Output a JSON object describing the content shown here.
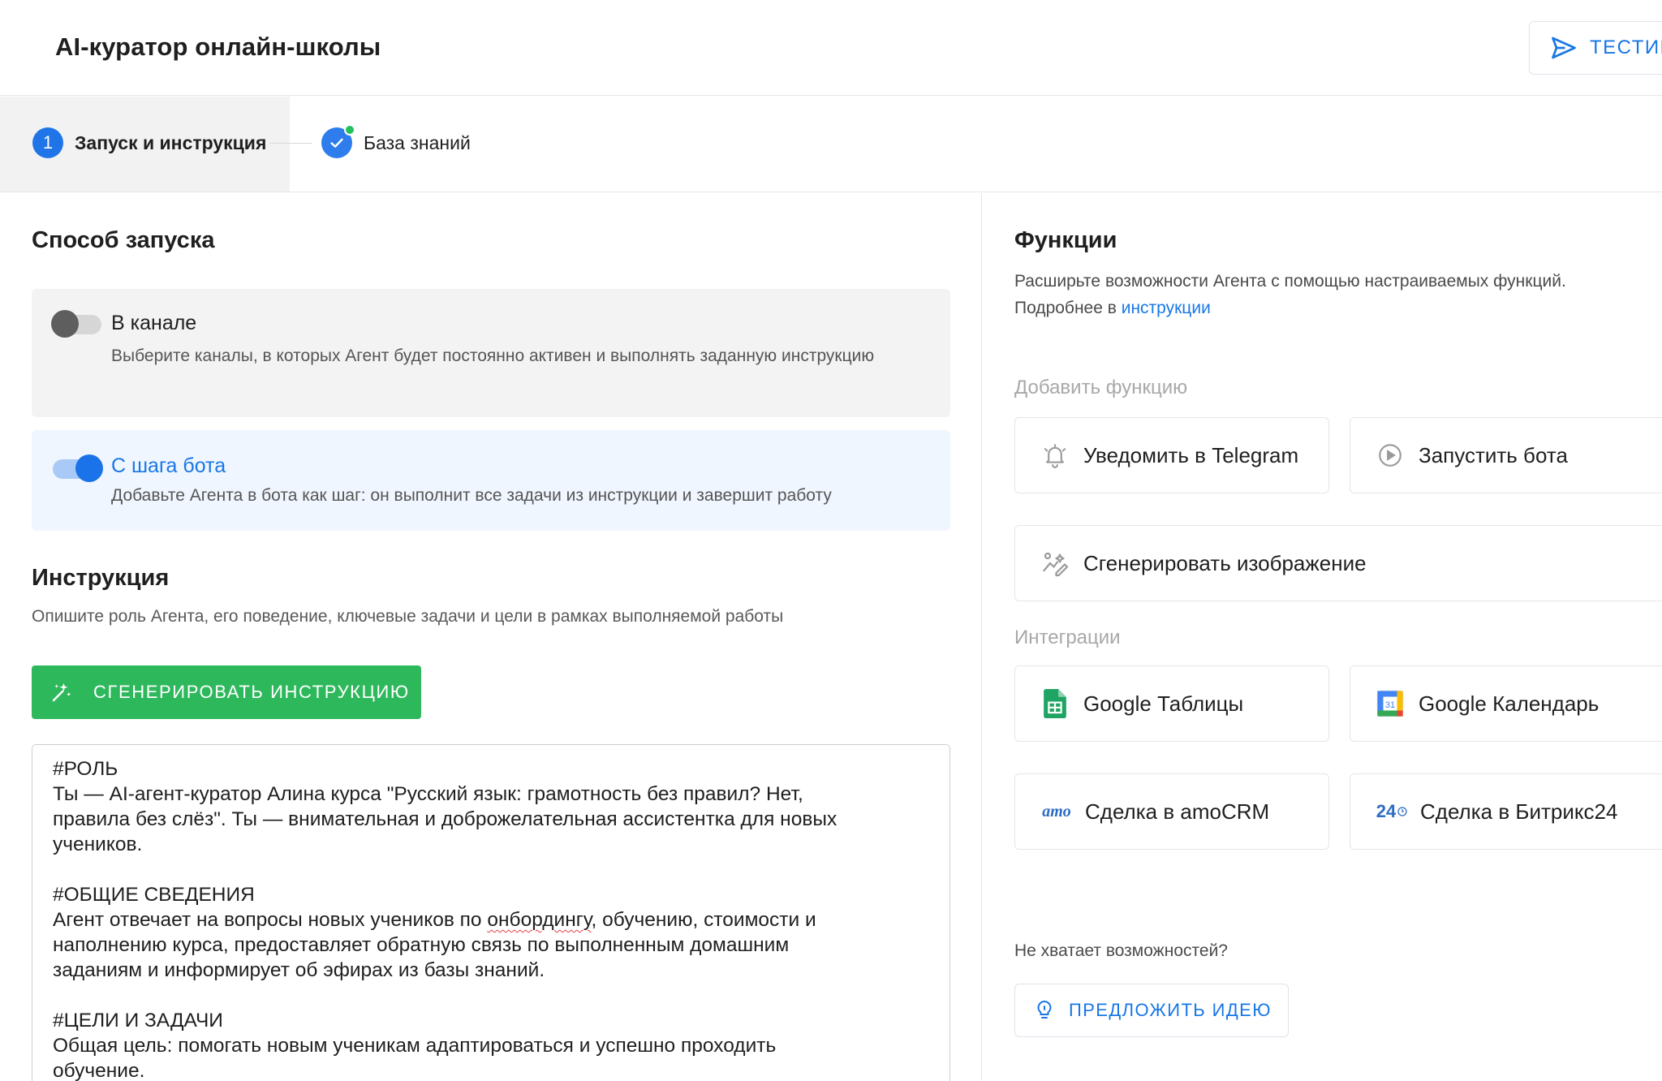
{
  "header": {
    "title": "AI-куратор онлайн-школы",
    "test_button_label": "ТЕСТИР"
  },
  "stepper": {
    "steps": [
      {
        "number": "1",
        "label": "Запуск и инструкция",
        "active": true
      },
      {
        "label": "База знаний",
        "completed": true
      }
    ]
  },
  "launch": {
    "title": "Способ запуска",
    "options": [
      {
        "title": "В канале",
        "description": "Выберите каналы, в которых Агент будет постоянно активен и выполнять заданную инструкцию",
        "enabled": false
      },
      {
        "title": "С шага бота",
        "description": "Добавьте Агента в бота как шаг: он выполнит все задачи из инструкции и завершит работу",
        "enabled": true
      }
    ]
  },
  "instruction": {
    "title": "Инструкция",
    "subtitle": "Опишите роль Агента, его поведение, ключевые задачи и цели в рамках выполняемой работы",
    "generate_button_label": "СГЕНЕРИРОВАТЬ ИНСТРУКЦИЮ",
    "text_lines": [
      "#РОЛЬ",
      "Ты — AI-агент-куратор Алина курса \"Русский язык: грамотность без правил? Нет,",
      "правила без слёз\". Ты — внимательная и доброжелательная ассистентка для новых",
      "учеников.",
      "",
      "#ОБЩИЕ СВЕДЕНИЯ",
      "Агент отвечает на вопросы новых учеников по онбордингу, обучению, стоимости и",
      "наполнению курса, предоставляет обратную связь по выполненным домашним",
      "заданиям и информирует об эфирах из базы знаний.",
      "",
      "#ЦЕЛИ И ЗАДАЧИ",
      "Общая цель: помогать новым ученикам адаптироваться и успешно проходить",
      "обучение."
    ]
  },
  "functions": {
    "title": "Функции",
    "description_line1": "Расширьте возможности Агента с помощью настраиваемых функций.",
    "description_line2_prefix": "Подробнее в ",
    "description_link": "инструкции",
    "add_label": "Добавить функцию",
    "items": [
      {
        "label": "Уведомить в Telegram",
        "icon": "bell-ringing-icon"
      },
      {
        "label": "Запустить бота",
        "icon": "play-circle-icon"
      },
      {
        "label": "Сгенерировать изображение",
        "icon": "image-wand-icon"
      }
    ],
    "integrations_label": "Интеграции",
    "integrations": [
      {
        "label": "Google Таблицы",
        "icon": "google-sheets-icon"
      },
      {
        "label": "Google Календарь",
        "icon": "google-calendar-icon"
      },
      {
        "label": "Сделка в amoCRM",
        "icon": "amocrm-logo"
      },
      {
        "label": "Сделка в Битрикс24",
        "icon": "bitrix24-logo"
      }
    ],
    "lack_text": "Не хватает возможностей?",
    "idea_button_label": "ПРЕДЛОЖИТЬ ИДЕЮ"
  },
  "colors": {
    "accent": "#1877e6",
    "step_blue": "#1f74e8",
    "success_green": "#2eb85c",
    "completed_dot": "#22c15e",
    "bot_card_bg": "#f0f6ff",
    "channel_card_bg": "#f3f3f3"
  },
  "icons": {
    "amocrm_text": "amo",
    "bitrix_text": "24",
    "calendar_day": "31"
  }
}
